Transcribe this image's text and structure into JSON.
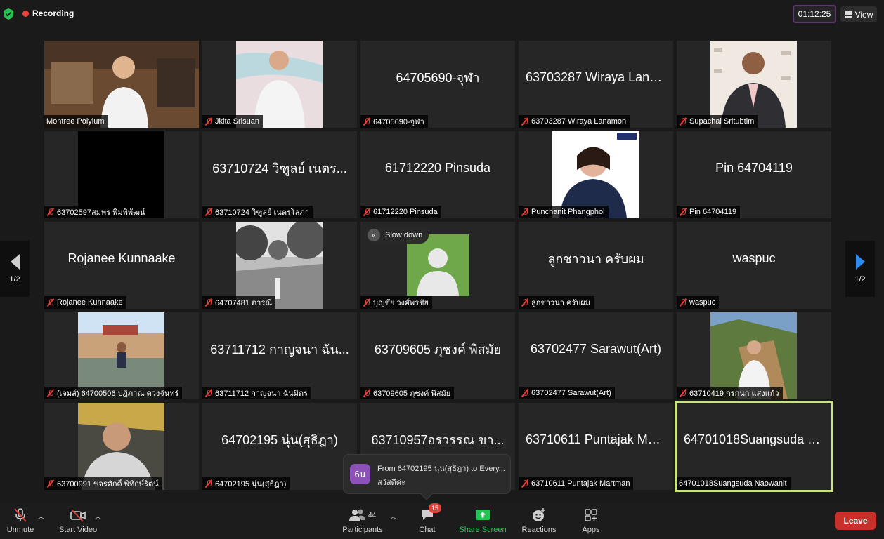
{
  "top_bar": {
    "recording_label": "Recording",
    "timer": "01:12:25",
    "view_label": "View"
  },
  "pagination": {
    "left_page": "1/2",
    "right_page": "1/2"
  },
  "tiles": [
    {
      "name": "Montree Polyium",
      "display": "",
      "muted": false
    },
    {
      "name": "Jkita Srisuan",
      "display": "",
      "muted": true
    },
    {
      "name": "64705690-จุฬา",
      "display": "64705690-จุฬา",
      "muted": true
    },
    {
      "name": "63703287 Wiraya Lanamon",
      "display": "63703287 Wiraya Lana...",
      "muted": true
    },
    {
      "name": "Supachai Sritubtim",
      "display": "",
      "muted": true
    },
    {
      "name": "63702597สมพร พิมพิพัฒน์",
      "display": "",
      "muted": true
    },
    {
      "name": "63710724 วิฑูลย์ เนตรโสภา",
      "display": "63710724 วิฑูลย์ เนตร...",
      "muted": true
    },
    {
      "name": "61712220 Pinsuda",
      "display": "61712220 Pinsuda",
      "muted": true
    },
    {
      "name": "Punchanit Phangphol",
      "display": "",
      "muted": true
    },
    {
      "name": "Pin 64704119",
      "display": "Pin 64704119",
      "muted": true
    },
    {
      "name": "Rojanee Kunnaake",
      "display": "Rojanee Kunnaake",
      "muted": true
    },
    {
      "name": "64707481 ดารณี",
      "display": "",
      "muted": true
    },
    {
      "name": "บุญชัย วงศ์พรชัย",
      "display": "",
      "muted": true
    },
    {
      "name": "ลูกชาวนา ครับผม",
      "display": "ลูกชาวนา ครับผม",
      "muted": true
    },
    {
      "name": "waspuc",
      "display": "waspuc",
      "muted": true
    },
    {
      "name": "(เจมส์) 64700506 ปฏิภาณ ดวงจันทร์",
      "display": "",
      "muted": true
    },
    {
      "name": "63711712 กาญจนา ฉันมิตร",
      "display": "63711712 กาญจนา ฉัน...",
      "muted": true
    },
    {
      "name": "63709605 ภุชงค์ พิสมัย",
      "display": "63709605 ภุชงค์ พิสมัย",
      "muted": true
    },
    {
      "name": "63702477 Sarawut(Art)",
      "display": "63702477 Sarawut(Art)",
      "muted": true
    },
    {
      "name": "63710419 กรกนก แสงแก้ว",
      "display": "",
      "muted": true
    },
    {
      "name": "63700991 ขจรศักดิ์ พิทักษ์รัตน์",
      "display": "",
      "muted": true
    },
    {
      "name": "64702195 นุ่น(สุธิฎา)",
      "display": "64702195 นุ่น(สุธิฎา)",
      "muted": true
    },
    {
      "name": "",
      "display": "63710957อรวรรณ ขา...",
      "muted": false
    },
    {
      "name": "63710611 Puntajak Martman",
      "display": "63710611 Puntajak Mar...",
      "muted": true
    },
    {
      "name": "64701018Suangsuda Naowanit",
      "display": "64701018Suangsuda N...",
      "muted": false
    }
  ],
  "slow_down_label": "Slow down",
  "chat_popup": {
    "avatar": "6น",
    "from": "From 64702195 นุ่น(สุธิฎา) to Every...",
    "message": "สวัสดีค่ะ"
  },
  "toolbar": {
    "unmute": "Unmute",
    "start_video": "Start Video",
    "participants": "Participants",
    "participants_count": "44",
    "chat": "Chat",
    "chat_badge": "15",
    "share_screen": "Share Screen",
    "reactions": "Reactions",
    "apps": "Apps",
    "leave": "Leave"
  },
  "colors": {
    "share_green": "#23c552",
    "leave_red": "#c8312b",
    "active_border": "#c8e37c",
    "page_arrow_blue": "#2e8cf0"
  }
}
